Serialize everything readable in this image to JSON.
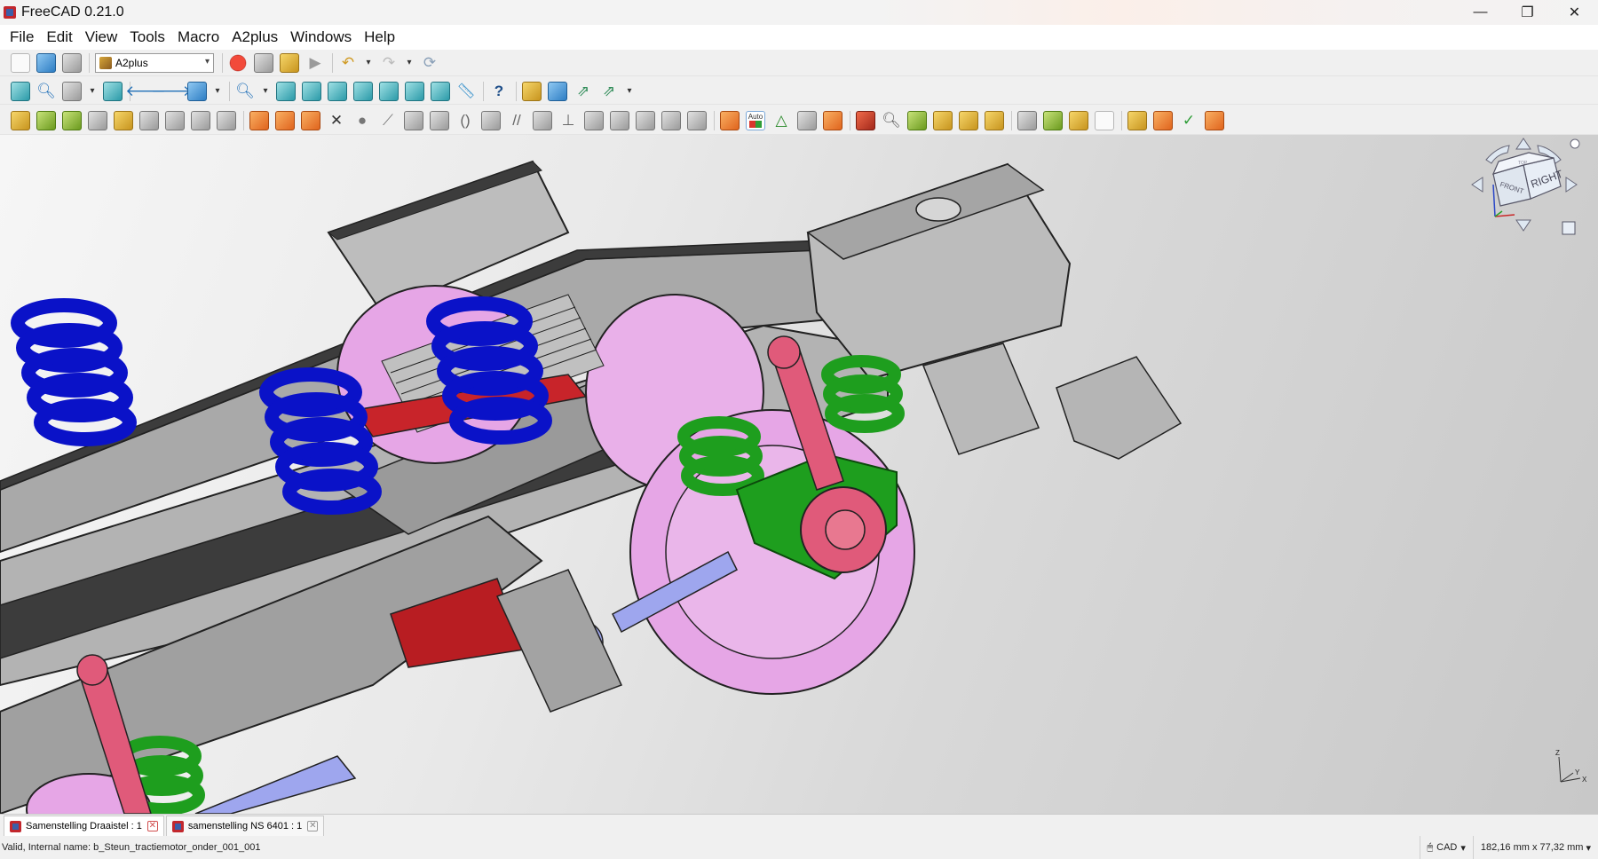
{
  "window": {
    "title": "FreeCAD 0.21.0",
    "controls": {
      "minimize": "—",
      "maximize": "❐",
      "close": "✕"
    }
  },
  "menubar": {
    "items": [
      "File",
      "Edit",
      "View",
      "Tools",
      "Macro",
      "A2plus",
      "Windows",
      "Help"
    ]
  },
  "toolbar": {
    "workbench": "A2plus",
    "auto_label": "Auto"
  },
  "navcube": {
    "faces": {
      "front": "FRONT",
      "right": "RIGHT",
      "top": "TOP"
    }
  },
  "axis_indicator": {
    "x": "X",
    "y": "Y",
    "z": "Z"
  },
  "tabs": [
    {
      "label": "Samenstelling Draaistel : 1",
      "active": true
    },
    {
      "label": "samenstelling NS 6401 : 1",
      "active": false
    }
  ],
  "statusbar": {
    "message": "Valid, Internal name: b_Steun_tractiemotor_onder_001_001",
    "navigation_style": "CAD",
    "dimensions": "182,16 mm x 77,32 mm"
  },
  "colors": {
    "spring_blue": "#0a12c8",
    "spring_green": "#1e9e1e",
    "wheel_pink": "#e6a6e6",
    "damper_red": "#e05a7a",
    "frame_grey": "#a9a9a9",
    "dark_face": "#3c3c3c",
    "link_lavender": "#9ea6ee"
  }
}
